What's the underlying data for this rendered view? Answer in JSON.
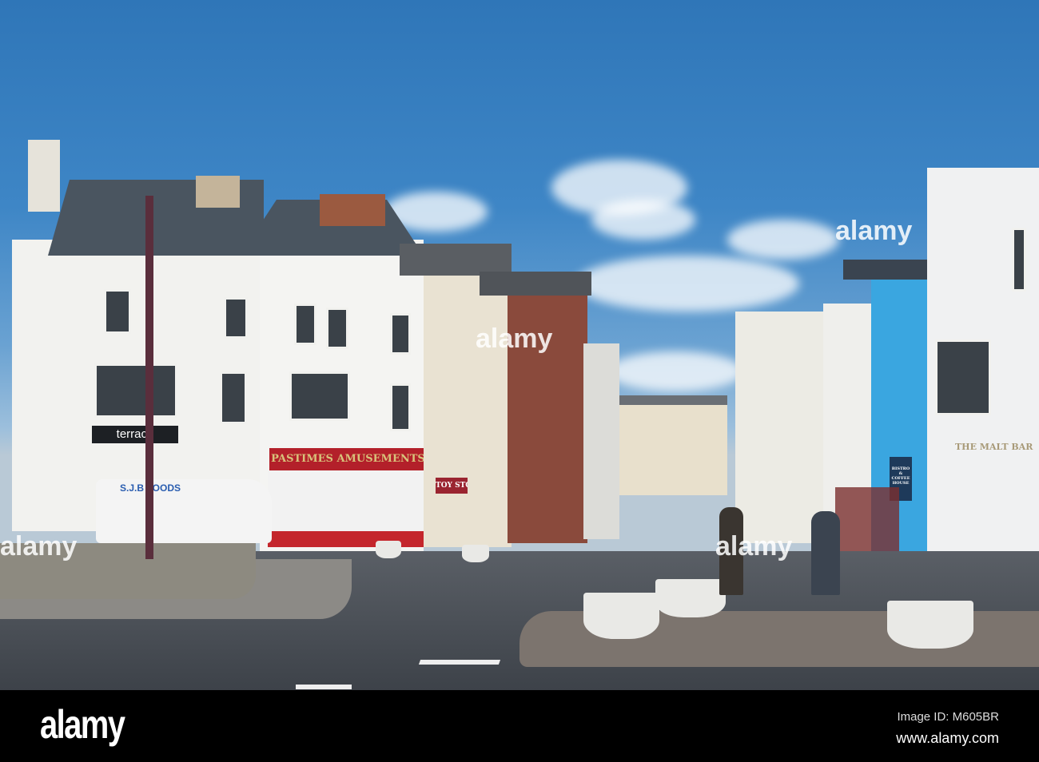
{
  "photo": {
    "signs": {
      "amusements": "PASTIMES AMUSEMENTS",
      "van": "S.J.B FOODS",
      "toy_store": "TOY STO",
      "terrace": "terrace",
      "bistro": "BISTRO & COFFEE HOUSE",
      "bar": "THE MALT BAR"
    },
    "watermark": "alamy"
  },
  "footer": {
    "logo": "alamy",
    "image_id": "Image ID: M605BR",
    "url": "www.alamy.com"
  },
  "colors": {
    "sky": "#3e86c6",
    "footer": "#000000",
    "blue_building": "#3aa6e0",
    "sign_red": "#b3202a"
  }
}
